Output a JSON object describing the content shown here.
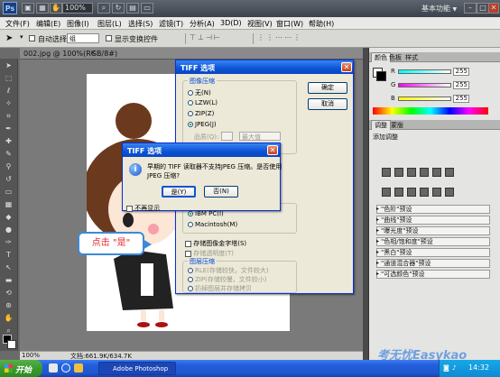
{
  "topbar": {
    "ps_logo": "Ps",
    "zoom": "100%",
    "workspace": "基本功能",
    "workspace_arrow": "▼"
  },
  "menubar": {
    "items": [
      "文件(F)",
      "编辑(E)",
      "图像(I)",
      "图层(L)",
      "选择(S)",
      "滤镜(T)",
      "分析(A)",
      "3D(D)",
      "视图(V)",
      "窗口(W)",
      "帮助(H)"
    ]
  },
  "options": {
    "auto_select_label": "自动选择:",
    "auto_select_value": "组",
    "show_transform": "显示变换控件"
  },
  "document": {
    "tab_title": "002.jpg @ 100%(RGB/8#)",
    "status_zoom": "100%",
    "status_doc": "文档:661.9K/634.7K"
  },
  "panels": {
    "color_tabs": [
      "颜色",
      "色板",
      "样式"
    ],
    "channels": [
      {
        "label": "R",
        "value": "255"
      },
      {
        "label": "G",
        "value": "255"
      },
      {
        "label": "B",
        "value": "255"
      }
    ],
    "adj_tabs": [
      "调整",
      "蒙版"
    ],
    "adj_title": "添加调整",
    "presets": [
      "\"色阶\"预设",
      "\"曲线\"预设",
      "\"曝光度\"预设",
      "\"色相/饱和度\"预设",
      "\"黑白\"预设",
      "\"通道混合器\"预设",
      "\"可选颜色\"预设"
    ]
  },
  "tiff_dialog": {
    "title": "TIFF 选项",
    "image_compression_label": "图像压缩",
    "compression_options": [
      "无(N)",
      "LZW(L)",
      "ZIP(Z)",
      "JPEG(J)"
    ],
    "quality_label": "品质(Q):",
    "quality_value": "最大值",
    "ok": "确定",
    "cancel": "取消",
    "pixel_order_options": [
      "IBM PC(I)",
      "Macintosh(M)"
    ],
    "save_pyramid": "存储图像金字塔(S)",
    "save_transparency": "存储透明度(T)",
    "layer_compression_label": "图层压缩",
    "layer_options": [
      "RLE(存储较快，文件较大)",
      "ZIP(存储较慢，文件较小)",
      "扔掉图层并存储拷贝"
    ]
  },
  "warning_dialog": {
    "title": "TIFF 选项",
    "message_line1": "早期的 TIFF 读取器不支持JPEG 压缩。是否使用",
    "message_line2": "JPEG 压缩?",
    "yes": "是(Y)",
    "no": "否(N)",
    "dont_show": "不再显示"
  },
  "callout": {
    "text": "点击 \"是\""
  },
  "taskbar": {
    "start": "开始",
    "task": "Adobe Photoshop ...",
    "clock": "14:32"
  },
  "watermark": "考无忧Easykao",
  "colors": {
    "accent": "#0a53d6",
    "callout_text": "#e8262a",
    "callout_border": "#3b8ad8"
  }
}
